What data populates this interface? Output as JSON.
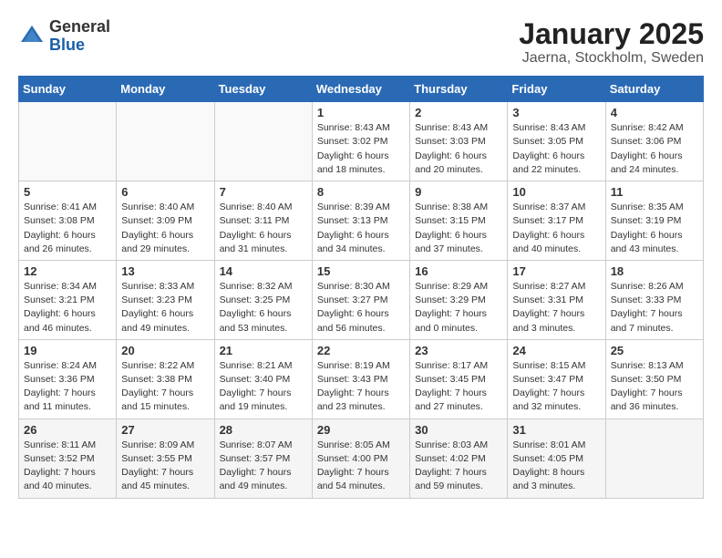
{
  "logo": {
    "general": "General",
    "blue": "Blue"
  },
  "title": "January 2025",
  "subtitle": "Jaerna, Stockholm, Sweden",
  "weekdays": [
    "Sunday",
    "Monday",
    "Tuesday",
    "Wednesday",
    "Thursday",
    "Friday",
    "Saturday"
  ],
  "weeks": [
    [
      {
        "day": "",
        "info": ""
      },
      {
        "day": "",
        "info": ""
      },
      {
        "day": "",
        "info": ""
      },
      {
        "day": "1",
        "info": "Sunrise: 8:43 AM\nSunset: 3:02 PM\nDaylight: 6 hours\nand 18 minutes."
      },
      {
        "day": "2",
        "info": "Sunrise: 8:43 AM\nSunset: 3:03 PM\nDaylight: 6 hours\nand 20 minutes."
      },
      {
        "day": "3",
        "info": "Sunrise: 8:43 AM\nSunset: 3:05 PM\nDaylight: 6 hours\nand 22 minutes."
      },
      {
        "day": "4",
        "info": "Sunrise: 8:42 AM\nSunset: 3:06 PM\nDaylight: 6 hours\nand 24 minutes."
      }
    ],
    [
      {
        "day": "5",
        "info": "Sunrise: 8:41 AM\nSunset: 3:08 PM\nDaylight: 6 hours\nand 26 minutes."
      },
      {
        "day": "6",
        "info": "Sunrise: 8:40 AM\nSunset: 3:09 PM\nDaylight: 6 hours\nand 29 minutes."
      },
      {
        "day": "7",
        "info": "Sunrise: 8:40 AM\nSunset: 3:11 PM\nDaylight: 6 hours\nand 31 minutes."
      },
      {
        "day": "8",
        "info": "Sunrise: 8:39 AM\nSunset: 3:13 PM\nDaylight: 6 hours\nand 34 minutes."
      },
      {
        "day": "9",
        "info": "Sunrise: 8:38 AM\nSunset: 3:15 PM\nDaylight: 6 hours\nand 37 minutes."
      },
      {
        "day": "10",
        "info": "Sunrise: 8:37 AM\nSunset: 3:17 PM\nDaylight: 6 hours\nand 40 minutes."
      },
      {
        "day": "11",
        "info": "Sunrise: 8:35 AM\nSunset: 3:19 PM\nDaylight: 6 hours\nand 43 minutes."
      }
    ],
    [
      {
        "day": "12",
        "info": "Sunrise: 8:34 AM\nSunset: 3:21 PM\nDaylight: 6 hours\nand 46 minutes."
      },
      {
        "day": "13",
        "info": "Sunrise: 8:33 AM\nSunset: 3:23 PM\nDaylight: 6 hours\nand 49 minutes."
      },
      {
        "day": "14",
        "info": "Sunrise: 8:32 AM\nSunset: 3:25 PM\nDaylight: 6 hours\nand 53 minutes."
      },
      {
        "day": "15",
        "info": "Sunrise: 8:30 AM\nSunset: 3:27 PM\nDaylight: 6 hours\nand 56 minutes."
      },
      {
        "day": "16",
        "info": "Sunrise: 8:29 AM\nSunset: 3:29 PM\nDaylight: 7 hours\nand 0 minutes."
      },
      {
        "day": "17",
        "info": "Sunrise: 8:27 AM\nSunset: 3:31 PM\nDaylight: 7 hours\nand 3 minutes."
      },
      {
        "day": "18",
        "info": "Sunrise: 8:26 AM\nSunset: 3:33 PM\nDaylight: 7 hours\nand 7 minutes."
      }
    ],
    [
      {
        "day": "19",
        "info": "Sunrise: 8:24 AM\nSunset: 3:36 PM\nDaylight: 7 hours\nand 11 minutes."
      },
      {
        "day": "20",
        "info": "Sunrise: 8:22 AM\nSunset: 3:38 PM\nDaylight: 7 hours\nand 15 minutes."
      },
      {
        "day": "21",
        "info": "Sunrise: 8:21 AM\nSunset: 3:40 PM\nDaylight: 7 hours\nand 19 minutes."
      },
      {
        "day": "22",
        "info": "Sunrise: 8:19 AM\nSunset: 3:43 PM\nDaylight: 7 hours\nand 23 minutes."
      },
      {
        "day": "23",
        "info": "Sunrise: 8:17 AM\nSunset: 3:45 PM\nDaylight: 7 hours\nand 27 minutes."
      },
      {
        "day": "24",
        "info": "Sunrise: 8:15 AM\nSunset: 3:47 PM\nDaylight: 7 hours\nand 32 minutes."
      },
      {
        "day": "25",
        "info": "Sunrise: 8:13 AM\nSunset: 3:50 PM\nDaylight: 7 hours\nand 36 minutes."
      }
    ],
    [
      {
        "day": "26",
        "info": "Sunrise: 8:11 AM\nSunset: 3:52 PM\nDaylight: 7 hours\nand 40 minutes."
      },
      {
        "day": "27",
        "info": "Sunrise: 8:09 AM\nSunset: 3:55 PM\nDaylight: 7 hours\nand 45 minutes."
      },
      {
        "day": "28",
        "info": "Sunrise: 8:07 AM\nSunset: 3:57 PM\nDaylight: 7 hours\nand 49 minutes."
      },
      {
        "day": "29",
        "info": "Sunrise: 8:05 AM\nSunset: 4:00 PM\nDaylight: 7 hours\nand 54 minutes."
      },
      {
        "day": "30",
        "info": "Sunrise: 8:03 AM\nSunset: 4:02 PM\nDaylight: 7 hours\nand 59 minutes."
      },
      {
        "day": "31",
        "info": "Sunrise: 8:01 AM\nSunset: 4:05 PM\nDaylight: 8 hours\nand 3 minutes."
      },
      {
        "day": "",
        "info": ""
      }
    ]
  ]
}
